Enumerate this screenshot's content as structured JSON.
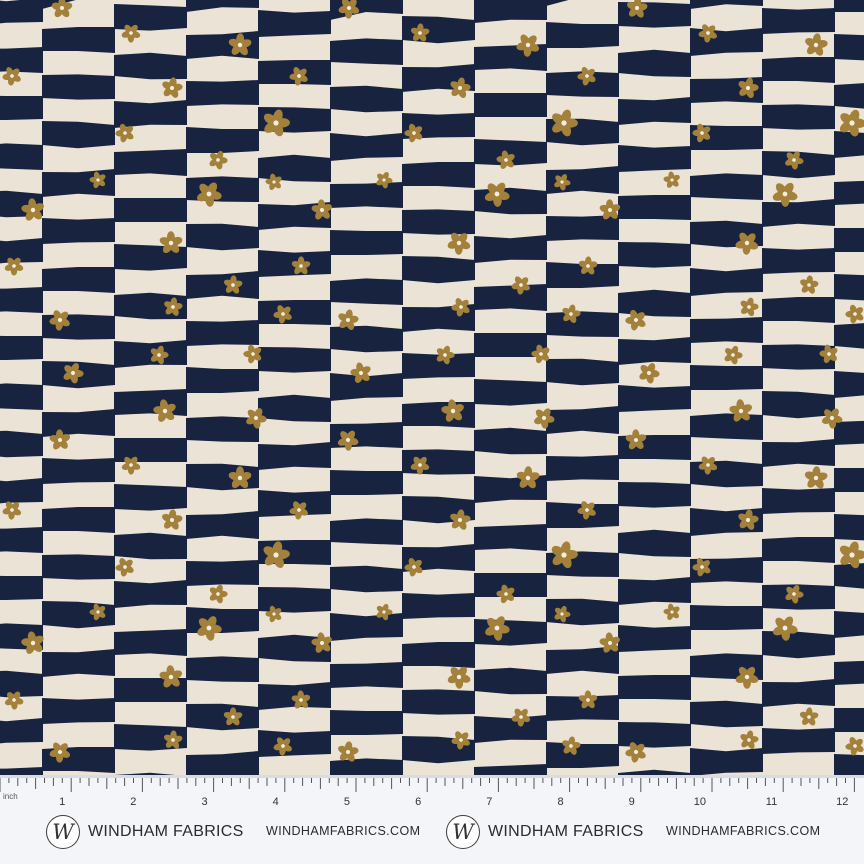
{
  "swatch": {
    "colors": {
      "navy": "#17233f",
      "cream": "#ebe3d6",
      "gold": "#a3813a",
      "center": "#f2ede0"
    },
    "motif": "daisy"
  },
  "ruler": {
    "unit_label": "inch",
    "numbers": [
      "1",
      "2",
      "3",
      "4",
      "5",
      "6",
      "7",
      "8",
      "9",
      "10",
      "11",
      "12"
    ]
  },
  "footer": {
    "logos": [
      {
        "monogram": "W",
        "brand": "WINDHAM FABRICS",
        "url": "WINDHAMFABRICS.COM"
      },
      {
        "monogram": "W",
        "brand": "WINDHAM FABRICS",
        "url": "WINDHAMFABRICS.COM"
      }
    ]
  }
}
